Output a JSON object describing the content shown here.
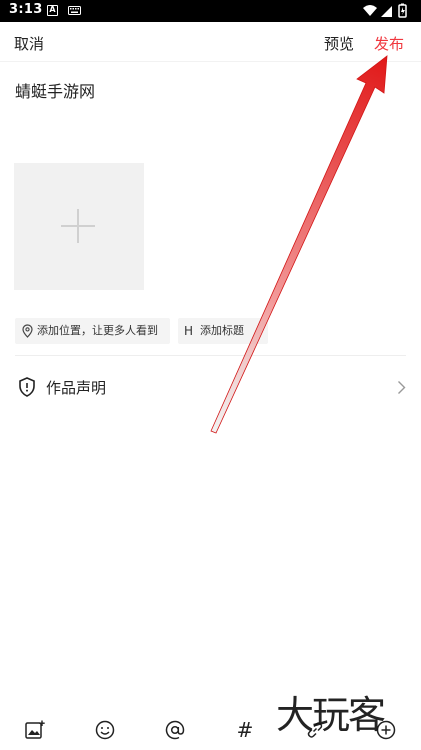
{
  "status_bar": {
    "time": "3:13",
    "notif_letter": "A"
  },
  "header": {
    "cancel_label": "取消",
    "preview_label": "预览",
    "publish_label": "发布",
    "publish_color": "#f0373e"
  },
  "editor": {
    "title_text": "蜻蜓手游网"
  },
  "chips": {
    "location_label": "添加位置，让更多人看到",
    "title_label": "添加标题",
    "title_icon_letter": "H"
  },
  "declaration": {
    "label": "作品声明"
  },
  "toolbar": {
    "hash_symbol": "#",
    "items": [
      "image-add-icon",
      "emoji-icon",
      "at-icon",
      "hashtag-icon",
      "link-icon",
      "add-circle-icon"
    ]
  },
  "watermark": {
    "text": "大玩客"
  },
  "colors": {
    "accent": "#f0373e",
    "placeholder_bg": "#f1f1f1",
    "chip_bg": "#f4f4f4"
  }
}
